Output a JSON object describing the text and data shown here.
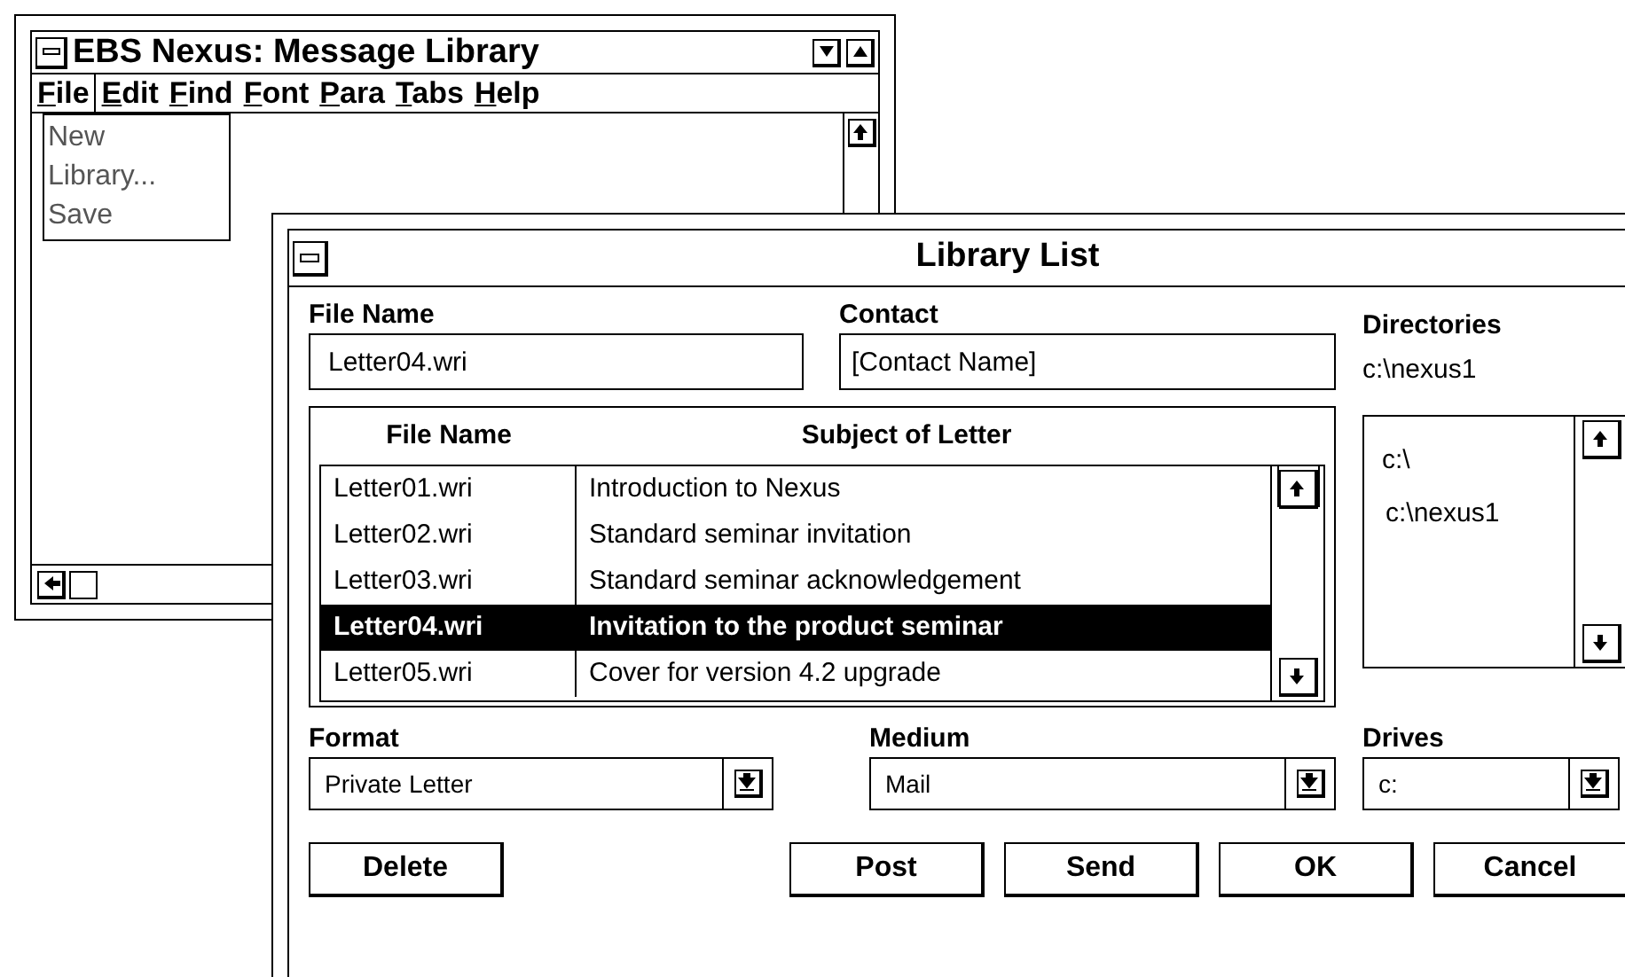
{
  "main_window": {
    "title": "EBS Nexus: Message Library",
    "menu": [
      {
        "label": "File",
        "selected": true
      },
      {
        "label": "Edit",
        "selected": false
      },
      {
        "label": "Find",
        "selected": false
      },
      {
        "label": "Font",
        "selected": false
      },
      {
        "label": "Para",
        "selected": false
      },
      {
        "label": "Tabs",
        "selected": false
      },
      {
        "label": "Help",
        "selected": false
      }
    ],
    "file_menu": [
      "New",
      "Library...",
      "Save"
    ]
  },
  "dialog": {
    "title": "Library List",
    "file_name": {
      "label": "File Name",
      "value": "Letter04.wri"
    },
    "contact": {
      "label": "Contact",
      "value": "[Contact Name]"
    },
    "directories": {
      "label": "Directories",
      "current": "c:\\nexus1",
      "items": [
        "c:\\",
        "c:\\nexus1"
      ]
    },
    "table": {
      "columns": [
        "File Name",
        "Subject of Letter"
      ],
      "rows": [
        {
          "file": "Letter01.wri",
          "subject": "Introduction to Nexus",
          "selected": false
        },
        {
          "file": "Letter02.wri",
          "subject": "Standard seminar invitation",
          "selected": false
        },
        {
          "file": "Letter03.wri",
          "subject": "Standard seminar acknowledgement",
          "selected": false
        },
        {
          "file": "Letter04.wri",
          "subject": "Invitation to the product seminar",
          "selected": true
        },
        {
          "file": "Letter05.wri",
          "subject": "Cover for version 4.2 upgrade",
          "selected": false
        }
      ]
    },
    "format": {
      "label": "Format",
      "value": "Private Letter"
    },
    "medium": {
      "label": "Medium",
      "value": "Mail"
    },
    "drives": {
      "label": "Drives",
      "value": "c:"
    },
    "buttons_left": [
      "Delete"
    ],
    "buttons_right": [
      "Post",
      "Send",
      "OK",
      "Cancel"
    ]
  }
}
